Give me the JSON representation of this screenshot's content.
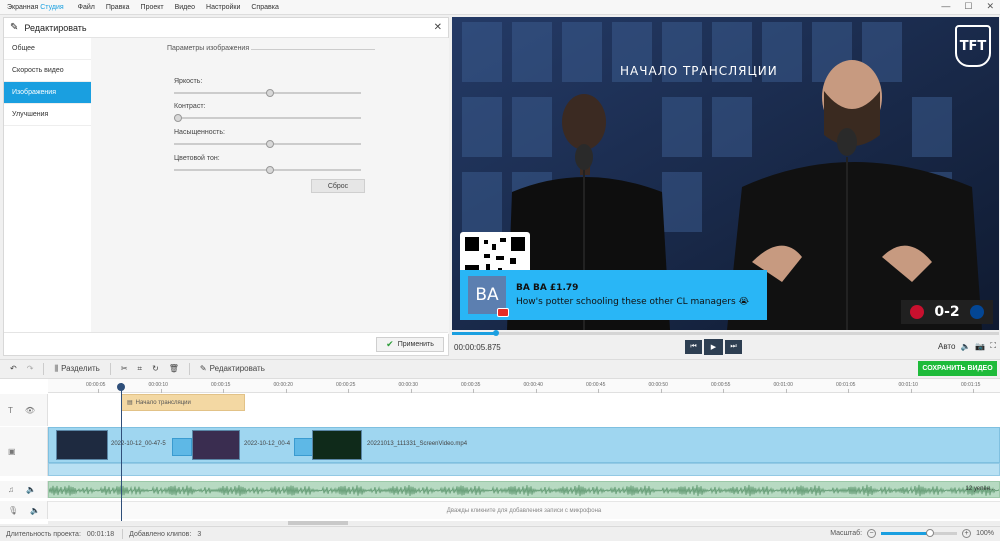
{
  "app": {
    "title_main": "Экранная ",
    "title_accent": "Студия",
    "menu": [
      "Файл",
      "Правка",
      "Проект",
      "Видео",
      "Настройки",
      "Справка"
    ]
  },
  "edit_panel": {
    "title": "Редактировать",
    "tabs": [
      "Общее",
      "Скорость видео",
      "Изображения",
      "Улучшения"
    ],
    "active_tab": 2,
    "group_title": "Параметры изображения",
    "sliders": [
      {
        "label": "Яркость:",
        "value": 0.5
      },
      {
        "label": "Контраст:",
        "value": 0.0
      },
      {
        "label": "Насыщенность:",
        "value": 0.5
      },
      {
        "label": "Цветовой тон:",
        "value": 0.5
      }
    ],
    "reset_label": "Сброс",
    "apply_label": "Применить"
  },
  "preview": {
    "overlay_title": "НАЧАЛО ТРАНСЛЯЦИИ",
    "logo_text": "TFT",
    "chat": {
      "avatar": "BA",
      "name": "BA BA   £1.79",
      "message": "How's potter schooling these other CL managers 😭"
    },
    "score": "0-2",
    "progress": 0.08
  },
  "player": {
    "timecode": "00:00:05.875",
    "auto_label": "Авто"
  },
  "toolbar": {
    "split_label": "Разделить",
    "edit_label": "Редактировать",
    "save_label": "СОХРАНИТЬ ВИДЕО"
  },
  "timeline": {
    "ticks": [
      "00:00:05",
      "00:00:10",
      "00:00:15",
      "00:00:20",
      "00:00:25",
      "00:00:30",
      "00:00:35",
      "00:00:40",
      "00:00:45",
      "00:00:50",
      "00:00:55",
      "00:01:00",
      "00:01:05",
      "00:01:10",
      "00:01:15"
    ],
    "title_clip": "Начало трансляции",
    "clips": [
      {
        "label": "2022-10-12_00-47-5"
      },
      {
        "label": "2022-10-12_00-4"
      },
      {
        "label": "20221013_111331_ScreenVideo.mp4"
      }
    ],
    "audio_label": "12 уепен...",
    "mic_hint": "Дважды кликните для добавления записи с микрофона"
  },
  "status": {
    "duration_label": "Длительность проекта:",
    "duration_value": "00:01:18",
    "clips_label": "Добавлено клипов:",
    "clips_value": "3",
    "zoom_label": "Масштаб:",
    "zoom_value": "100%",
    "zoom_fraction": 0.65
  },
  "colors": {
    "accent": "#1a9fe0",
    "save": "#1ebb3a",
    "chat": "#29b6f6"
  }
}
